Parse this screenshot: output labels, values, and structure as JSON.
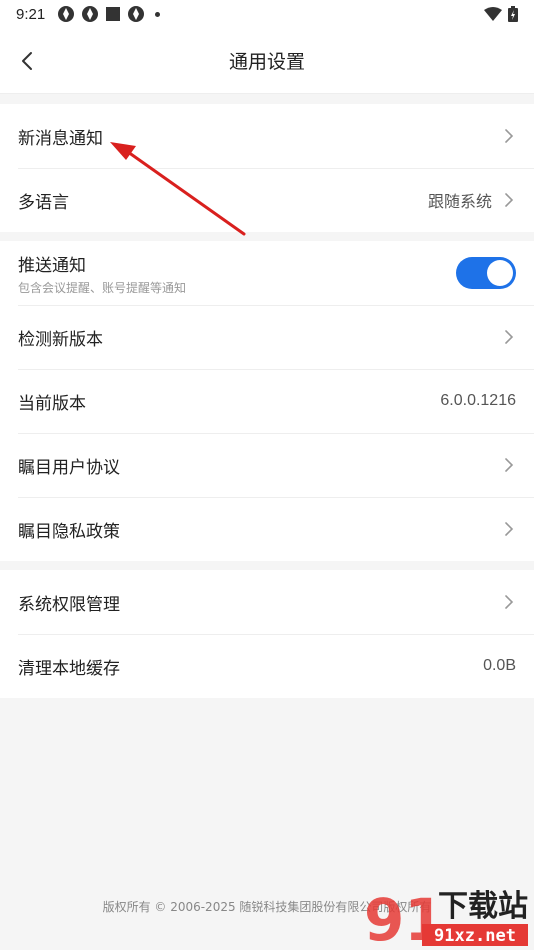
{
  "status_bar": {
    "time": "9:21"
  },
  "header": {
    "title": "通用设置"
  },
  "group1": {
    "items": [
      {
        "label": "新消息通知"
      },
      {
        "label": "多语言",
        "value": "跟随系统"
      }
    ]
  },
  "group2": {
    "push": {
      "label": "推送通知",
      "sub": "包含会议提醒、账号提醒等通知",
      "enabled": true
    },
    "items": [
      {
        "label": "检测新版本"
      },
      {
        "label": "当前版本",
        "value": "6.0.0.1216"
      },
      {
        "label": "瞩目用户协议"
      },
      {
        "label": "瞩目隐私政策"
      }
    ]
  },
  "group3": {
    "items": [
      {
        "label": "系统权限管理"
      },
      {
        "label": "清理本地缓存",
        "value": "0.0B"
      }
    ]
  },
  "footer": {
    "copyright": "版权所有 © 2006-2025 随锐科技集团股份有限公司版权所有"
  },
  "watermark": {
    "brand": "下载站",
    "url": "91xz.net",
    "number": "91"
  },
  "colors": {
    "accent": "#1e72e8",
    "annotation_arrow": "#d9201e"
  }
}
